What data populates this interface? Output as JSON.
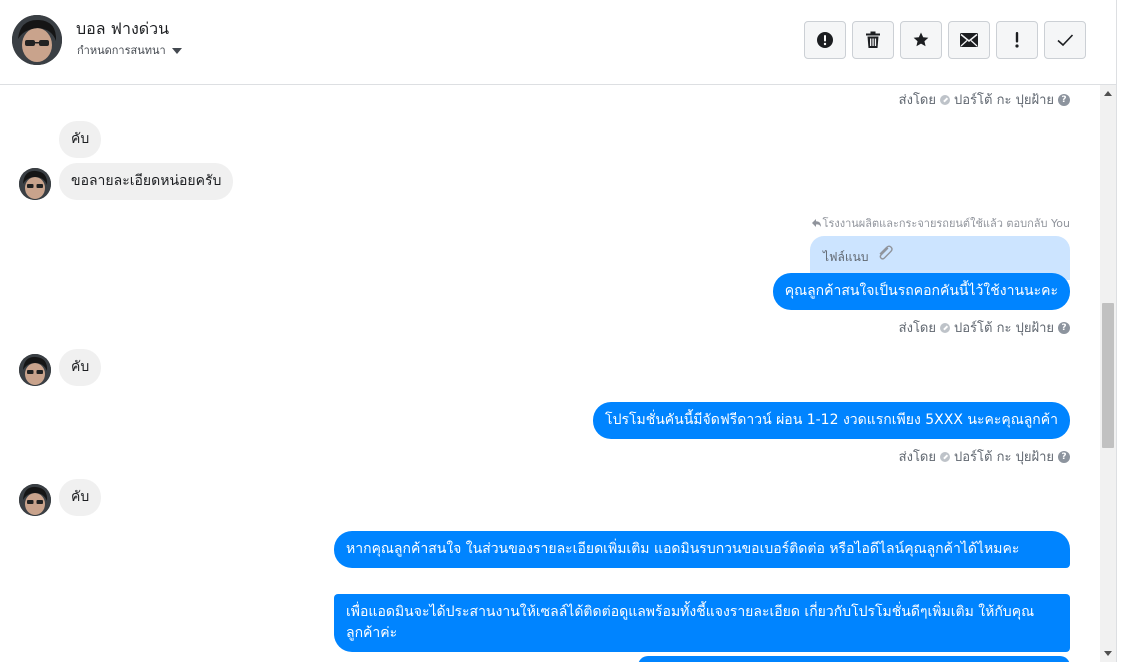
{
  "header": {
    "contact_name": "บอล ฟางด่วน",
    "assign_label": "กำหนดการสนทนา"
  },
  "toolbar": {
    "buttons": [
      {
        "name": "spam-alert",
        "icon": "alert-circle-icon"
      },
      {
        "name": "delete",
        "icon": "trash-icon"
      },
      {
        "name": "star",
        "icon": "star-icon"
      },
      {
        "name": "mark-unread",
        "icon": "envelope-icon"
      },
      {
        "name": "follow-up",
        "icon": "exclamation-icon"
      },
      {
        "name": "mark-done",
        "icon": "check-icon"
      }
    ]
  },
  "sent_by": {
    "prefix": "ส่งโดย",
    "agent": "ปอร์โต้ กะ ปุยฝ้าย",
    "help": "?"
  },
  "messages": [
    {
      "id": "m1",
      "direction": "in",
      "text": "คับ"
    },
    {
      "id": "m2",
      "direction": "in",
      "text": "ขอลายละเอียดหน่อยครับ"
    },
    {
      "id": "m3",
      "direction": "out",
      "reply_note": "โรงงานผลิตและกระจายรถยนต์ใช้แล้ว ตอบกลับ You",
      "attachment_label": "ไฟล์แนบ",
      "text": "คุณลูกค้าสนใจเป็นรถคอกคันนี้ไว้ใช้งานนะคะ"
    },
    {
      "id": "m4",
      "direction": "in",
      "text": "คับ"
    },
    {
      "id": "m5",
      "direction": "out",
      "text": "โปรโมชั่นคันนี้มีจัดฟรีดาวน์ ผ่อน 1-12 งวดแรกเพียง 5XXX นะคะคุณลูกค้า"
    },
    {
      "id": "m6",
      "direction": "in",
      "text": "คับ"
    },
    {
      "id": "m7",
      "direction": "out",
      "text": "หากคุณลูกค้าสนใจ ในส่วนของรายละเอียดเพิ่มเติม แอดมินรบกวนขอเบอร์ติดต่อ หรือไอดีไลน์คุณลูกค้าได้ไหมคะ"
    },
    {
      "id": "m8",
      "direction": "out",
      "text": "เพื่อแอดมินจะได้ประสานงานให้เซลล์ได้ติดต่อดูแลพร้อมทั้งชี้แจงรายละเอียด เกี่ยวกับโปรโมชั่นดีๆเพิ่มเติม ให้กับคุณลูกค้าค่ะ"
    }
  ],
  "colors": {
    "outgoing_bubble": "#0084ff",
    "incoming_bubble": "#f0f0f0",
    "attachment_card": "#cce4ff"
  }
}
